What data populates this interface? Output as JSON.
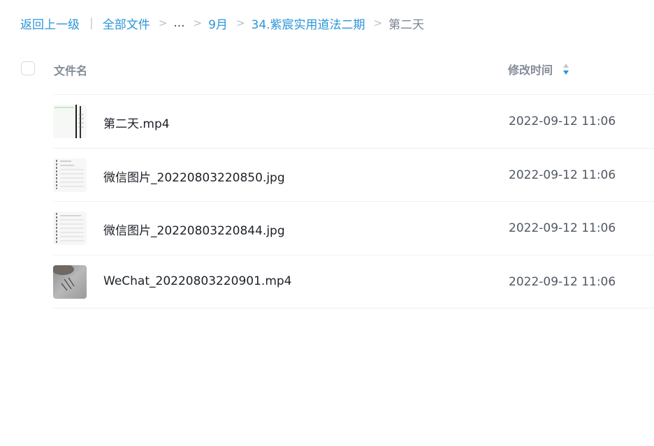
{
  "breadcrumb": {
    "back": "返回上一级",
    "divider": "|",
    "all_files": "全部文件",
    "separator": ">",
    "ellipsis": "...",
    "month": "9月",
    "folder": "34.紫宸实用道法二期",
    "current": "第二天"
  },
  "table": {
    "header": {
      "name": "文件名",
      "modified": "修改时间"
    },
    "rows": [
      {
        "name": "第二天.mp4",
        "modified": "2022-09-12 11:06",
        "thumb_icon": "video-thumbnail-icon"
      },
      {
        "name": "微信图片_20220803220850.jpg",
        "modified": "2022-09-12 11:06",
        "thumb_icon": "image-thumbnail-icon"
      },
      {
        "name": "微信图片_20220803220844.jpg",
        "modified": "2022-09-12 11:06",
        "thumb_icon": "image-thumbnail-icon"
      },
      {
        "name": "WeChat_20220803220901.mp4",
        "modified": "2022-09-12 11:06",
        "thumb_icon": "video-thumbnail-icon"
      }
    ]
  },
  "colors": {
    "link": "#2b95d9",
    "sort_active": "#2b95d9",
    "sort_inactive": "#c3c9d2",
    "text_primary": "#1c2127",
    "text_secondary": "#505862",
    "header_text": "#848c98"
  }
}
